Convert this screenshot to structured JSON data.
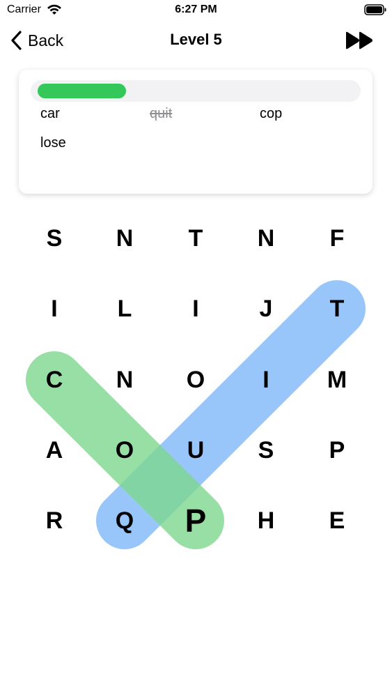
{
  "status_bar": {
    "carrier": "Carrier",
    "time": "6:27 PM"
  },
  "nav": {
    "back_label": "Back",
    "title": "Level 5"
  },
  "progress": {
    "fraction": 0.28,
    "color": "#34c759"
  },
  "words": [
    {
      "text": "car",
      "found": false
    },
    {
      "text": "quit",
      "found": true
    },
    {
      "text": "cop",
      "found": false
    },
    {
      "text": "lose",
      "found": false
    }
  ],
  "grid": {
    "rows": [
      [
        "S",
        "N",
        "T",
        "N",
        "F"
      ],
      [
        "I",
        "L",
        "I",
        "J",
        "T"
      ],
      [
        "C",
        "N",
        "O",
        "I",
        "M"
      ],
      [
        "A",
        "O",
        "U",
        "S",
        "P"
      ],
      [
        "R",
        "Q",
        "P",
        "H",
        "E"
      ]
    ],
    "emphasized_cell": [
      4,
      2
    ]
  },
  "highlights": [
    {
      "color": "#7fb8fa",
      "from": [
        4,
        1
      ],
      "to": [
        1,
        4
      ]
    },
    {
      "color": "#7fd88f",
      "from": [
        2,
        0
      ],
      "to": [
        4,
        2
      ]
    }
  ],
  "colors": {
    "accent": "#34c759",
    "found_word": "#8e8e93"
  }
}
